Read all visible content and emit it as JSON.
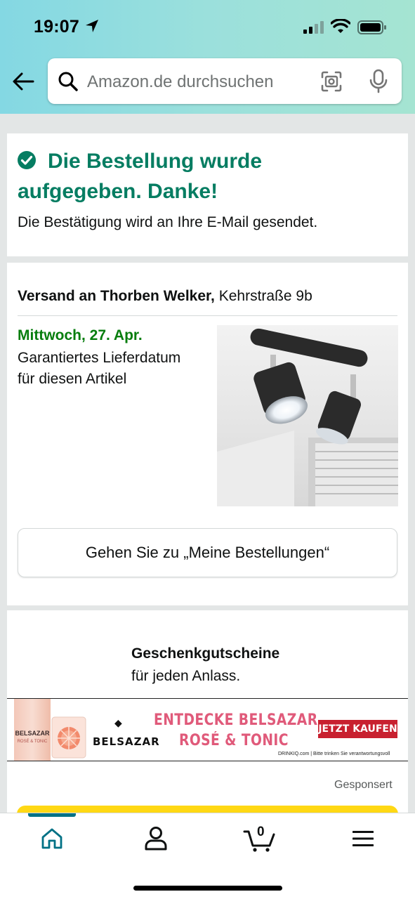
{
  "status_bar": {
    "time": "19:07"
  },
  "search": {
    "placeholder": "Amazon.de durchsuchen"
  },
  "order_confirmation": {
    "title": "Die Bestellung wurde aufgegeben. Danke!",
    "message": "Die Bestätigung wird an Ihre E-Mail gesendet."
  },
  "shipping": {
    "label": "Versand an Thorben Welker,",
    "address": " Kehrstraße 9b",
    "delivery_date": "Mittwoch, 27. Apr.",
    "delivery_note": "Garantiertes Lieferdatum für diesen Artikel",
    "orders_button": "Gehen Sie zu „Meine Bestellungen“"
  },
  "promo": {
    "title": "Geschenkgutscheine",
    "subtitle": "für jeden Anlass.",
    "ad": {
      "can_brand": "BELSAZAR",
      "can_sub": "ROSÉ & TONIC",
      "brand": "BELSAZAR",
      "headline1": "ENTDECKE BELSAZAR",
      "headline2": "ROSÉ & TONIC",
      "cta": "JETZT KAUFEN",
      "disclaimer": "DRINKIQ.com | Bitte trinken Sie verantwortungsvoll"
    },
    "sponsored": "Gesponsert"
  },
  "bottom_nav": {
    "cart_count": "0",
    "active": "home"
  },
  "colors": {
    "accent": "#067d62",
    "delivery_green": "#067d0d",
    "nav_active": "#007185",
    "cta_yellow": "#ffd814"
  }
}
